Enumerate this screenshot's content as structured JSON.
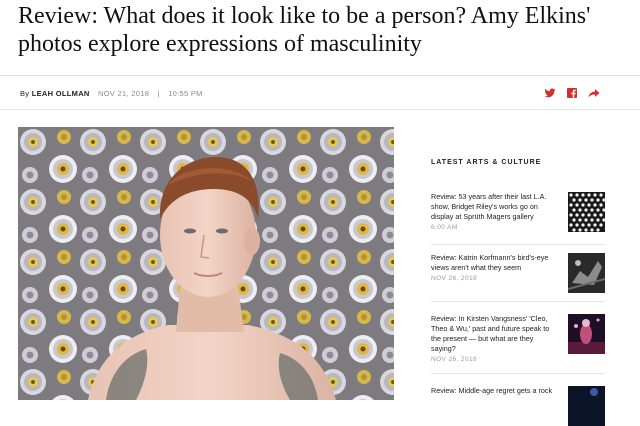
{
  "article": {
    "headline": "Review: What does it look like to be a person? Amy Elkins' photos explore expressions of masculinity",
    "byline_prefix": "By",
    "author": "LEAH OLLMAN",
    "date": "NOV 21, 2018",
    "separator": "|",
    "time": "10:55 PM"
  },
  "share": {
    "twitter_icon": "twitter-icon",
    "facebook_icon": "facebook-icon",
    "share_icon": "share-arrow-icon",
    "icon_color": "#d0312d"
  },
  "hero_image": {
    "description_icon": "portrait-photo"
  },
  "sidebar": {
    "heading": "LATEST ARTS & CULTURE",
    "stories": [
      {
        "title": "Review: 53 years after their last L.A. show, Bridget Riley's works go on display at Sprüth Magers gallery",
        "time": "6:00 AM"
      },
      {
        "title": "Review: Katrin Korfmann's bird's-eye views aren't what they seem",
        "time": "NOV 26, 2018"
      },
      {
        "title": "Review: In Kirsten Vangsness' 'Cleo, Theo & Wu,' past and future speak to the present — but what are they saying?",
        "time": "NOV 26, 2018"
      },
      {
        "title": "Review: Middle-age regret gets a rock",
        "time": ""
      }
    ]
  }
}
